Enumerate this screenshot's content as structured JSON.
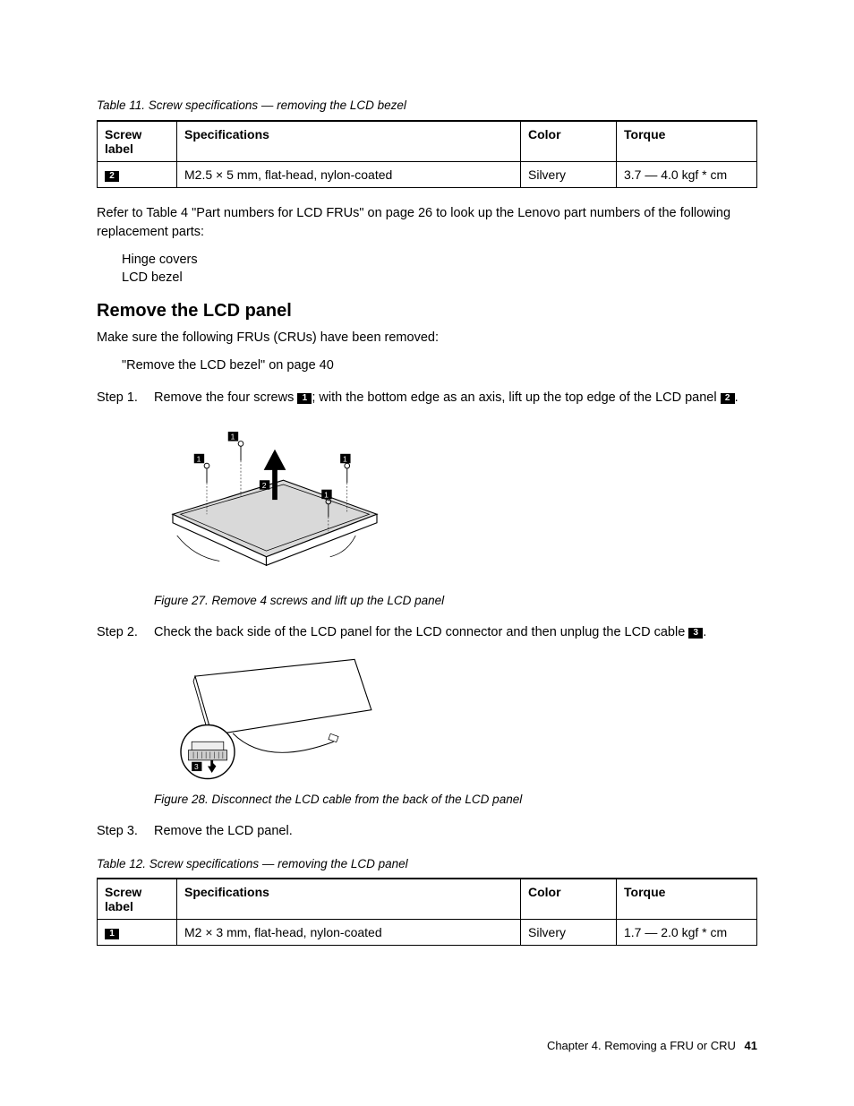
{
  "table11": {
    "caption": "Table 11.  Screw specifications — removing the LCD bezel",
    "headers": [
      "Screw label",
      "Specifications",
      "Color",
      "Torque"
    ],
    "row": {
      "label": "2",
      "spec": "M2.5 × 5 mm, flat-head, nylon-coated",
      "color": "Silvery",
      "torque": "3.7 — 4.0 kgf * cm"
    }
  },
  "refer_text_a": "Refer to Table 4 \"Part numbers for LCD FRUs\" on page 26 to look up the Lenovo part numbers of the following replacement parts:",
  "replacement_parts": [
    "Hinge covers",
    "LCD bezel"
  ],
  "section_heading": "Remove the LCD panel",
  "intro_text": "Make sure the following FRUs (CRUs) have been removed:",
  "prereq": "\"Remove the LCD bezel\" on page 40",
  "step1": {
    "label": "Step 1.",
    "text_a": "Remove the four screws ",
    "callout1": "1",
    "text_b": "; with the bottom edge as an axis, lift up the top edge of the LCD panel ",
    "callout2": "2",
    "text_c": "."
  },
  "figure27": {
    "caption": "Figure 27.  Remove 4 screws and lift up the LCD panel",
    "callouts": [
      "1",
      "1",
      "1",
      "1",
      "2"
    ]
  },
  "step2": {
    "label": "Step 2.",
    "text_a": "Check the back side of the LCD panel for the LCD connector and then unplug the LCD cable ",
    "callout": "3",
    "text_b": "."
  },
  "figure28": {
    "caption": "Figure 28.  Disconnect the LCD cable from the back of the LCD panel",
    "callout": "3"
  },
  "step3": {
    "label": "Step 3.",
    "text": "Remove the LCD panel."
  },
  "table12": {
    "caption": "Table 12.  Screw specifications — removing the LCD panel",
    "headers": [
      "Screw label",
      "Specifications",
      "Color",
      "Torque"
    ],
    "row": {
      "label": "1",
      "spec": "M2 × 3 mm, flat-head, nylon-coated",
      "color": "Silvery",
      "torque": "1.7 — 2.0 kgf * cm"
    }
  },
  "footer": {
    "chapter": "Chapter 4.  Removing a FRU or CRU",
    "page": "41"
  }
}
